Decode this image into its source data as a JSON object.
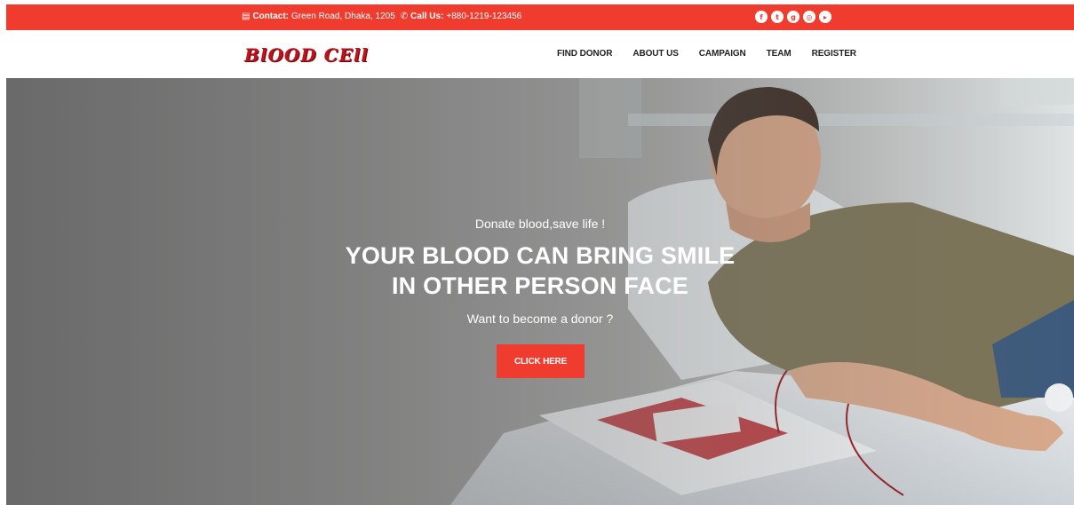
{
  "topbar": {
    "contact_label": "Contact:",
    "contact_value": "Green Road, Dhaka, 1205",
    "call_label": "Call Us:",
    "call_value": "+880-1219-123456",
    "background": "#f03c2e",
    "socials": [
      {
        "name": "facebook-icon",
        "glyph": "f"
      },
      {
        "name": "twitter-icon",
        "glyph": "t"
      },
      {
        "name": "google-plus-icon",
        "glyph": "g"
      },
      {
        "name": "instagram-icon",
        "glyph": "◎"
      },
      {
        "name": "youtube-icon",
        "glyph": "▸"
      }
    ]
  },
  "header": {
    "logo_text": "BlOOD CEll",
    "logo_color": "#c0121b",
    "nav": [
      {
        "label": "FIND DONOR"
      },
      {
        "label": "ABOUT US"
      },
      {
        "label": "CAMPAIGN"
      },
      {
        "label": "TEAM"
      },
      {
        "label": "REGISTER"
      }
    ]
  },
  "hero": {
    "tagline": "Donate blood,save life !",
    "headline_line1": "YOUR BLOOD CAN BRING SMILE",
    "headline_line2": "IN OTHER PERSON FACE",
    "question": "Want to become a donor ?",
    "cta_label": "CLICK HERE",
    "cta_color": "#f03c2e"
  }
}
